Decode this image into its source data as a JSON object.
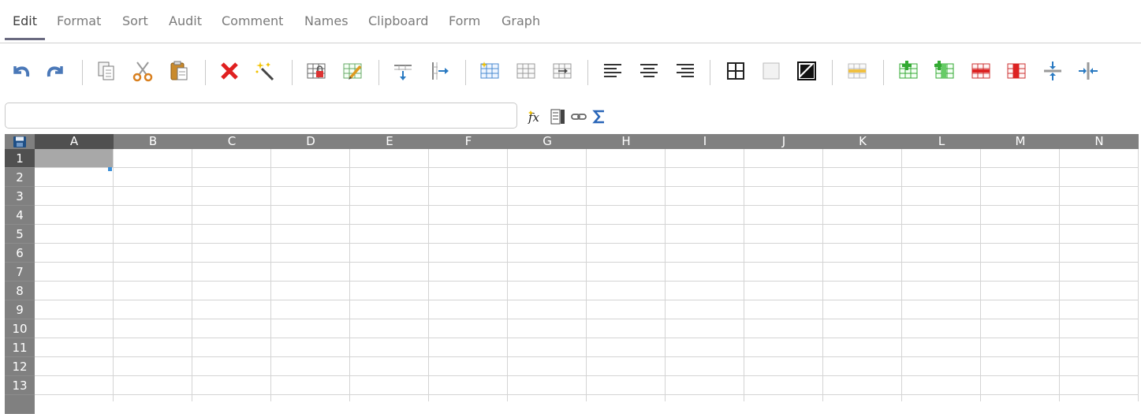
{
  "tabs": [
    {
      "label": "Edit",
      "active": true
    },
    {
      "label": "Format",
      "active": false
    },
    {
      "label": "Sort",
      "active": false
    },
    {
      "label": "Audit",
      "active": false
    },
    {
      "label": "Comment",
      "active": false
    },
    {
      "label": "Names",
      "active": false
    },
    {
      "label": "Clipboard",
      "active": false
    },
    {
      "label": "Form",
      "active": false
    },
    {
      "label": "Graph",
      "active": false
    }
  ],
  "toolbar": {
    "buttons": [
      {
        "name": "undo-icon"
      },
      {
        "name": "redo-icon"
      },
      {
        "name": "copy-icon"
      },
      {
        "name": "cut-icon"
      },
      {
        "name": "paste-icon"
      },
      {
        "name": "delete-icon"
      },
      {
        "name": "erase-icon"
      },
      {
        "name": "lock-cells-icon"
      },
      {
        "name": "edit-cells-icon"
      },
      {
        "name": "fill-down-icon"
      },
      {
        "name": "fill-right-icon"
      },
      {
        "name": "merge-cells-icon"
      },
      {
        "name": "unmerge-cells-icon"
      },
      {
        "name": "move-cells-icon"
      },
      {
        "name": "align-left-icon"
      },
      {
        "name": "align-center-icon"
      },
      {
        "name": "align-right-icon"
      },
      {
        "name": "borders-icon"
      },
      {
        "name": "no-border-icon"
      },
      {
        "name": "swap-colors-icon"
      },
      {
        "name": "hide-row-icon"
      },
      {
        "name": "insert-row-icon"
      },
      {
        "name": "insert-column-icon"
      },
      {
        "name": "delete-row-icon"
      },
      {
        "name": "delete-column-icon"
      },
      {
        "name": "pane-rows-icon"
      },
      {
        "name": "pane-columns-icon"
      }
    ]
  },
  "formula_bar": {
    "value": "",
    "placeholder": ""
  },
  "formula_buttons": [
    {
      "name": "function-icon"
    },
    {
      "name": "multiline-icon"
    },
    {
      "name": "link-icon"
    },
    {
      "name": "sum-icon"
    }
  ],
  "sheet": {
    "columns": [
      "A",
      "B",
      "C",
      "D",
      "E",
      "F",
      "G",
      "H",
      "I",
      "J",
      "K",
      "L",
      "M",
      "N"
    ],
    "rows": [
      "1",
      "2",
      "3",
      "4",
      "5",
      "6",
      "7",
      "8",
      "9",
      "10",
      "11",
      "12",
      "13"
    ],
    "selected_cell": "A1"
  },
  "colors": {
    "header_bg": "#808080",
    "header_selected": "#505050",
    "accent": "#6a6a80",
    "selection": "#a8a8a8"
  }
}
